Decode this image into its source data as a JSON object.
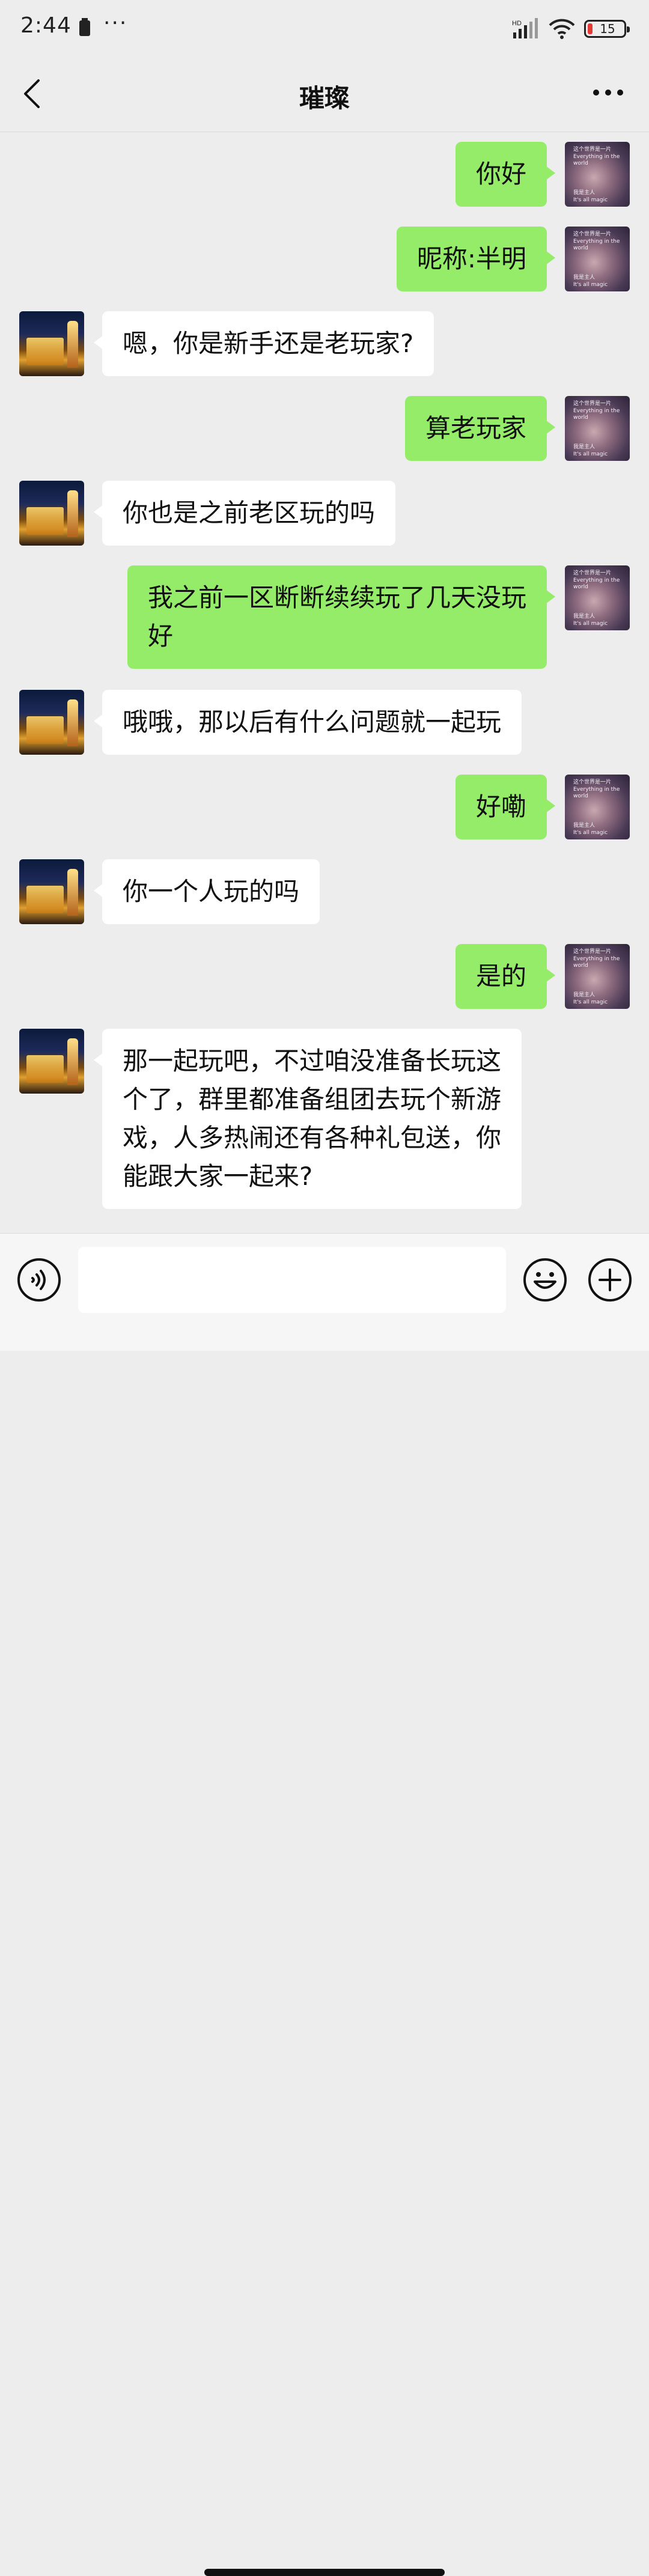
{
  "status_bar": {
    "time": "2:44",
    "dots": "···",
    "network": "HD",
    "battery_level": "15",
    "battery_color": "#e53935"
  },
  "nav": {
    "title": "璀璨"
  },
  "colors": {
    "outgoing_bubble": "#95ec69",
    "incoming_bubble": "#ffffff",
    "background": "#ededed"
  },
  "self_avatar_text": {
    "line1": "这个世界是一片",
    "line2": "Everything in the world",
    "line3": "我是主人",
    "line4": "It's all magic"
  },
  "messages": [
    {
      "side": "right",
      "text": "你好"
    },
    {
      "side": "right",
      "text": "昵称:半明"
    },
    {
      "side": "left",
      "text": "嗯，你是新手还是老玩家?"
    },
    {
      "side": "right",
      "text": "算老玩家"
    },
    {
      "side": "left",
      "text": "你也是之前老区玩的吗"
    },
    {
      "side": "right",
      "text": "我之前一区断断续续玩了几天没玩\n好"
    },
    {
      "side": "left",
      "text": "哦哦，那以后有什么问题就一起玩"
    },
    {
      "side": "right",
      "text": "好嘞"
    },
    {
      "side": "left",
      "text": "你一个人玩的吗"
    },
    {
      "side": "right",
      "text": "是的"
    },
    {
      "side": "left",
      "text": "那一起玩吧，不过咱没准备长玩这\n个了，群里都准备组团去玩个新游\n戏，人多热闹还有各种礼包送，你\n能跟大家一起来?"
    }
  ],
  "input": {
    "value": "",
    "placeholder": ""
  },
  "icons": {
    "back": "back-icon",
    "more": "more-icon",
    "voice": "voice-icon",
    "emoji": "emoji-icon",
    "plus": "plus-icon"
  }
}
